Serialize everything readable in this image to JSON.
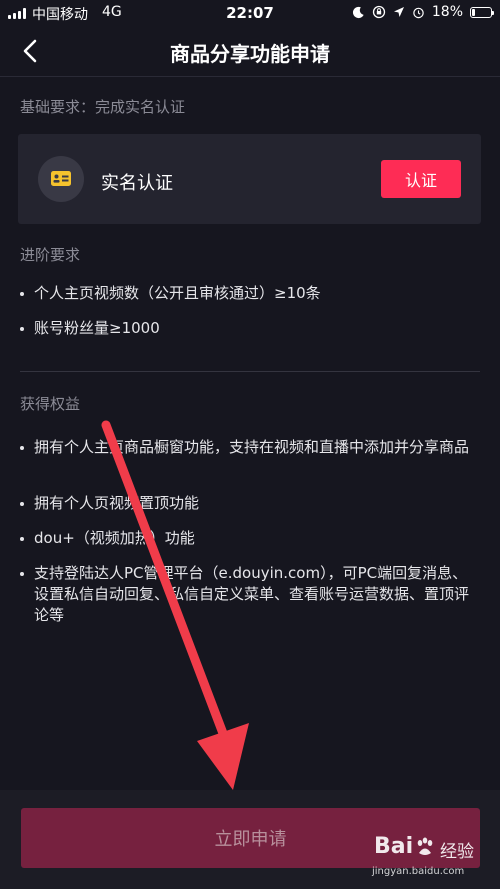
{
  "status_bar": {
    "carrier": "中国移动",
    "network": "4G",
    "time": "22:07",
    "battery_percent": "18%",
    "battery_level": 0.18,
    "icons": [
      "moon-icon",
      "orientation-lock-icon",
      "location-icon",
      "alarm-icon"
    ]
  },
  "nav": {
    "title": "商品分享功能申请",
    "back_icon": "chevron-left-icon"
  },
  "basic": {
    "label": "基础要求：完成实名认证",
    "card_label": "实名认证",
    "card_icon": "id-card-icon",
    "button_label": "认证"
  },
  "advanced": {
    "label": "进阶要求",
    "items": [
      "个人主页视频数（公开且审核通过）≥10条",
      "账号粉丝量≥1000"
    ]
  },
  "benefits": {
    "label": "获得权益",
    "items": [
      "拥有个人主页商品橱窗功能，支持在视频和直播中添加并分享商品",
      "拥有个人页视频置顶功能",
      "dou+（视频加热）功能",
      "支持登陆达人PC管理平台（e.douyin.com），可PC端回复消息、设置私信自动回复、私信自定义菜单、查看账号运营数据、置顶评论等"
    ]
  },
  "footer": {
    "apply_label": "立即申请"
  },
  "watermark": {
    "brand": "Bai",
    "brand_suffix": "经验",
    "url": "jingyan.baidu.com"
  },
  "colors": {
    "background": "#16161f",
    "card": "#24242f",
    "accent": "#fe2c55",
    "apply_disabled": "#76213f",
    "annotation_arrow": "#f03c4a",
    "id_icon": "#f6c32d"
  }
}
